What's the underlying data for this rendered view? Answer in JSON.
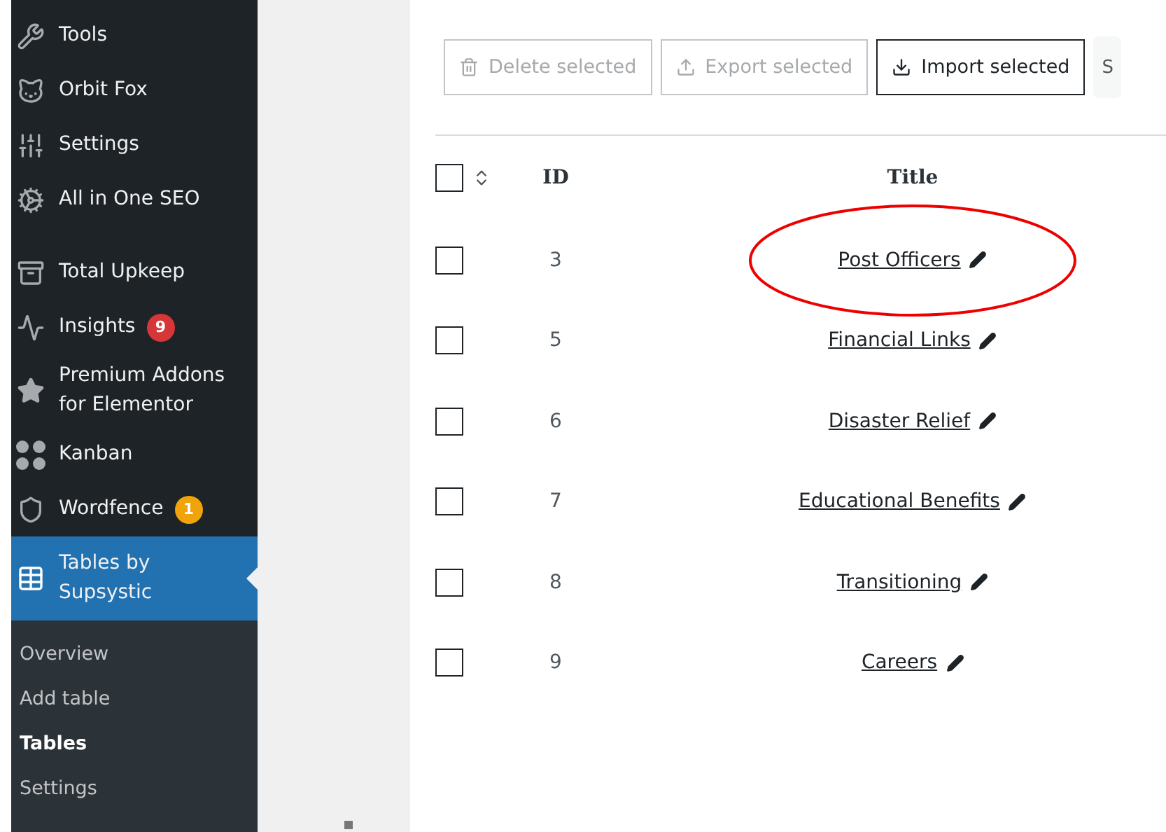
{
  "sidebar": {
    "items": [
      {
        "label": "Tools",
        "selected": false
      },
      {
        "label": "Orbit Fox",
        "selected": false
      },
      {
        "label": "Settings",
        "selected": false
      },
      {
        "label": "All in One SEO",
        "selected": false
      },
      {
        "label": "Total Upkeep",
        "selected": false
      },
      {
        "label": "Insights",
        "selected": false,
        "badge": "9",
        "color": "#d63638"
      },
      {
        "label": "Premium Addons for Elementor",
        "selected": false
      },
      {
        "label": "Kanban",
        "selected": false
      },
      {
        "label": "Wordfence",
        "selected": false,
        "badge": "1",
        "color": "#f0a30a"
      },
      {
        "label": "Tables by Supsystic",
        "selected": true
      }
    ],
    "submenu": [
      {
        "label": "Overview",
        "selected": false
      },
      {
        "label": "Add table",
        "selected": false
      },
      {
        "label": "Tables",
        "selected": true
      },
      {
        "label": "Settings",
        "selected": false
      }
    ]
  },
  "toolbar": {
    "buttons": [
      {
        "label": "Delete selected",
        "disabled": true
      },
      {
        "label": "Export selected",
        "disabled": true
      },
      {
        "label": "Import selected",
        "disabled": false
      }
    ],
    "search_partial": "S"
  },
  "table": {
    "select_all_checked": false,
    "columns": [
      "ID",
      "Title"
    ],
    "rows": [
      {
        "id": "3",
        "title": "Post Officers",
        "checked": false,
        "circled": true
      },
      {
        "id": "5",
        "title": "Financial Links",
        "checked": false,
        "circled": false
      },
      {
        "id": "6",
        "title": "Disaster Relief",
        "checked": false,
        "circled": false
      },
      {
        "id": "7",
        "title": "Educational Benefits",
        "checked": false,
        "circled": false
      },
      {
        "id": "8",
        "title": "Transitioning",
        "checked": false,
        "circled": false
      },
      {
        "id": "9",
        "title": "Careers",
        "checked": false,
        "circled": false
      }
    ]
  }
}
